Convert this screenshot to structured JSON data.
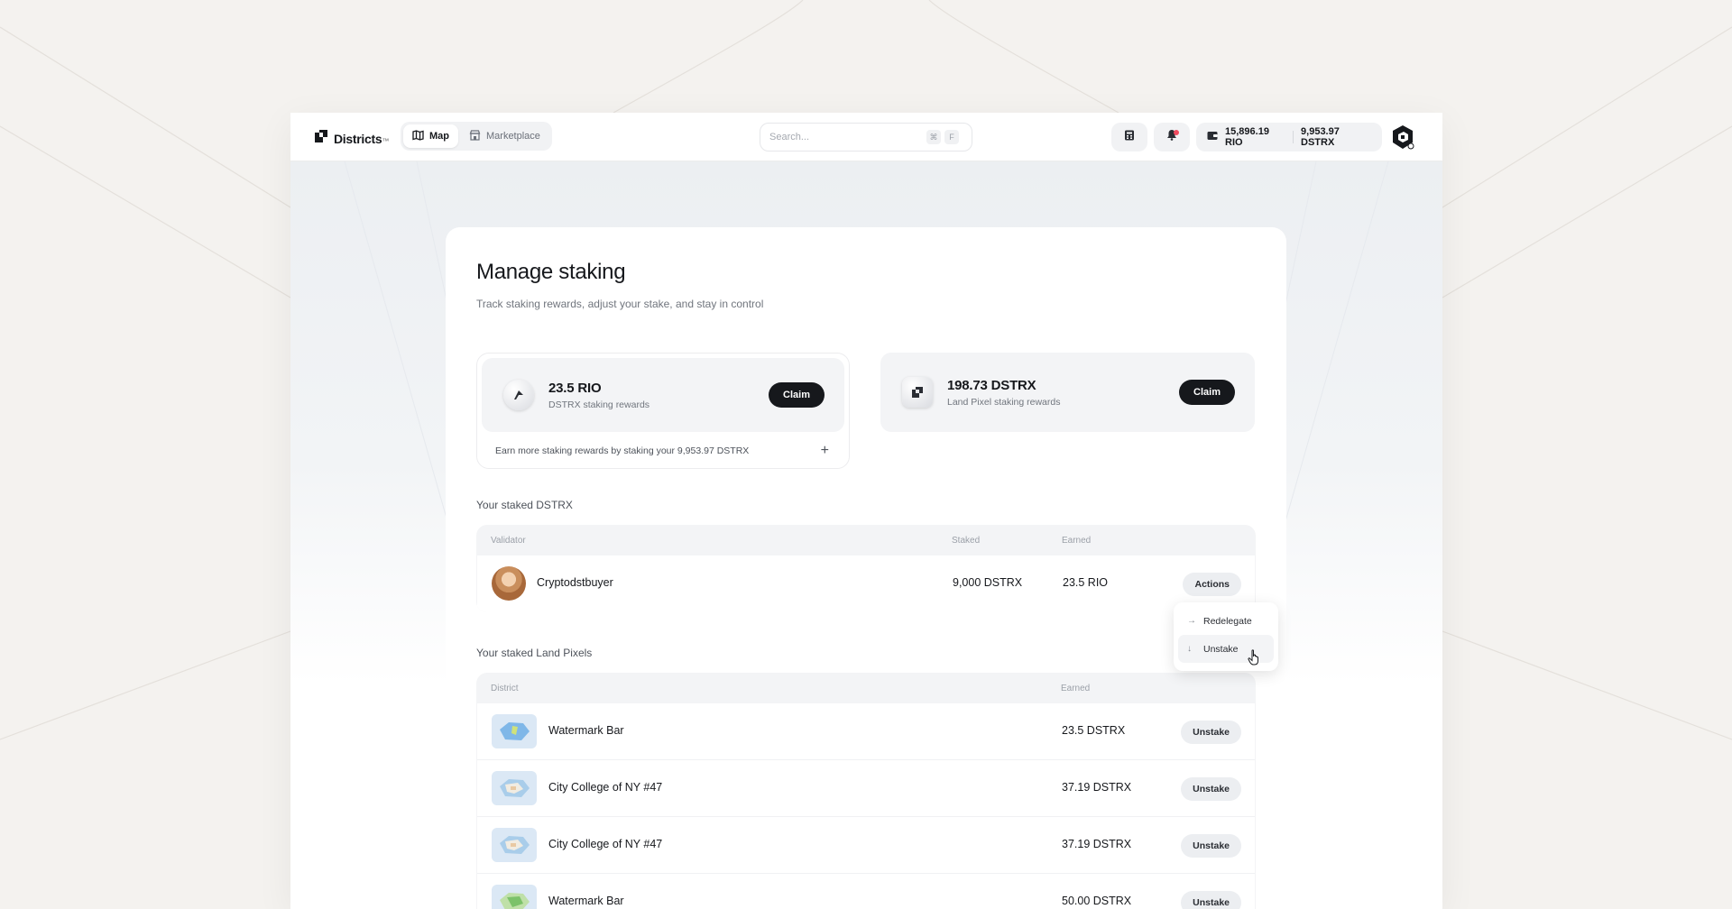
{
  "brand": {
    "name": "Districts",
    "mark": "™"
  },
  "nav": {
    "tabs": [
      {
        "label": "Map",
        "active": true,
        "icon": "map-icon"
      },
      {
        "label": "Marketplace",
        "active": false,
        "icon": "store-icon"
      }
    ]
  },
  "search": {
    "placeholder": "Search...",
    "shortcut": [
      "⌘",
      "F"
    ]
  },
  "header": {
    "wallet": {
      "rio": "15,896.19 RIO",
      "dstrx": "9,953.97 DSTRX"
    },
    "notification_dot": true
  },
  "page": {
    "title": "Manage staking",
    "subtitle": "Track staking rewards, adjust your stake, and stay in control"
  },
  "rewards": [
    {
      "amount": "23.5 RIO",
      "label": "DSTRX staking rewards",
      "action": "Claim"
    },
    {
      "amount": "198.73 DSTRX",
      "label": "Land Pixel staking rewards",
      "action": "Claim"
    }
  ],
  "earn_more": "Earn more staking rewards by staking your 9,953.97 DSTRX",
  "staked_dstrx": {
    "title": "Your staked DSTRX",
    "columns": [
      "Validator",
      "Staked",
      "Earned"
    ],
    "rows": [
      {
        "validator": "Cryptodstbuyer",
        "staked": "9,000 DSTRX",
        "earned": "23.5 RIO",
        "action": "Actions"
      }
    ]
  },
  "actions_menu": {
    "items": [
      {
        "label": "Redelegate",
        "icon": "arrow-right-icon"
      },
      {
        "label": "Unstake",
        "icon": "arrow-down-icon"
      }
    ]
  },
  "staked_pixels": {
    "title": "Your staked Land Pixels",
    "columns": [
      "District",
      "Earned"
    ],
    "rows": [
      {
        "district": "Watermark Bar",
        "earned": "23.5 DSTRX",
        "action": "Unstake"
      },
      {
        "district": "City College of NY #47",
        "earned": "37.19 DSTRX",
        "action": "Unstake"
      },
      {
        "district": "City College of NY #47",
        "earned": "37.19 DSTRX",
        "action": "Unstake"
      },
      {
        "district": "Watermark Bar",
        "earned": "50.00 DSTRX",
        "action": "Unstake"
      }
    ]
  },
  "colors": {
    "accent_dark": "#16181c",
    "notification": "#ef4b5f",
    "surface": "#f3f4f6"
  }
}
